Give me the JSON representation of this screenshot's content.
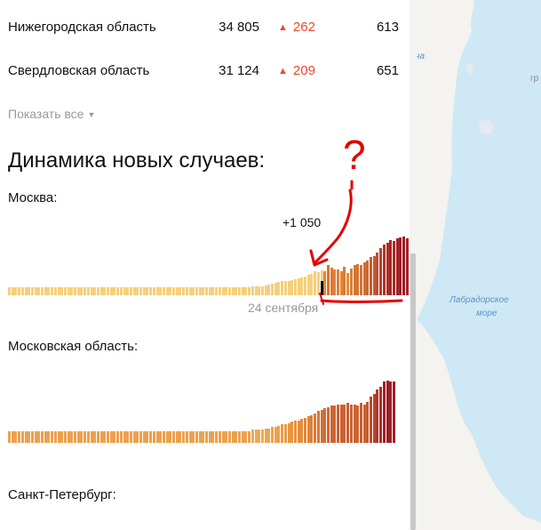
{
  "regions": [
    {
      "name": "Нижегородская область",
      "total": "34 805",
      "delta": "262",
      "deaths": "613"
    },
    {
      "name": "Свердловская область",
      "total": "31 124",
      "delta": "209",
      "deaths": "651"
    }
  ],
  "show_all": "Показать все",
  "dynamics_title": "Динамика новых случаев:",
  "charts": {
    "moscow": {
      "label": "Москва:",
      "annotation": "+1 050",
      "date": "24 сентября"
    },
    "moscow_oblast": {
      "label": "Московская область:"
    },
    "spb": {
      "label": "Санкт-Петербург:"
    }
  },
  "map": {
    "labels": [
      "Лабрадорское",
      "море",
      "на",
      "гр"
    ]
  },
  "annotation_mark": "?",
  "colors": {
    "accent_red": "#f0452c",
    "bar_light": "#f5d07a",
    "bar_dark": "#9e1c26",
    "map_water": "#cfe8f5",
    "map_land": "#f4f3ef"
  },
  "chart_data": [
    {
      "type": "bar",
      "title": "Москва:",
      "annotation": "+1 050",
      "x_tick": "24 сентября",
      "values": [
        9,
        9,
        9,
        9,
        9,
        9,
        9,
        9,
        9,
        9,
        9,
        9,
        9,
        9,
        9,
        9,
        9,
        9,
        9,
        9,
        9,
        9,
        9,
        9,
        9,
        9,
        9,
        9,
        9,
        9,
        9,
        9,
        9,
        9,
        9,
        9,
        9,
        9,
        9,
        9,
        9,
        9,
        9,
        9,
        9,
        9,
        9,
        9,
        9,
        9,
        9,
        9,
        9,
        9,
        9,
        9,
        9,
        9,
        9,
        9,
        9,
        9,
        9,
        9,
        9,
        9,
        9,
        9,
        9,
        9,
        9,
        9,
        9,
        9,
        10,
        10,
        10,
        10,
        11,
        12,
        13,
        14,
        15,
        16,
        16,
        16,
        17,
        18,
        19,
        20,
        21,
        23,
        24,
        27,
        26,
        28,
        27,
        33,
        31,
        29,
        29,
        27,
        32,
        25,
        30,
        33,
        34,
        33,
        36,
        38,
        42,
        43,
        47,
        52,
        56,
        58,
        61,
        60,
        63,
        64,
        65,
        63
      ]
    },
    {
      "type": "bar",
      "title": "Московская область:",
      "values": [
        9,
        9,
        9,
        9,
        9,
        9,
        9,
        9,
        9,
        9,
        9,
        9,
        9,
        9,
        9,
        9,
        9,
        9,
        9,
        9,
        9,
        9,
        9,
        9,
        9,
        9,
        9,
        9,
        9,
        9,
        9,
        9,
        9,
        9,
        9,
        9,
        9,
        9,
        9,
        9,
        9,
        9,
        9,
        9,
        9,
        9,
        9,
        9,
        9,
        9,
        9,
        9,
        9,
        9,
        9,
        9,
        9,
        9,
        9,
        9,
        9,
        9,
        9,
        9,
        9,
        9,
        9,
        9,
        9,
        9,
        9,
        9,
        9,
        9,
        10,
        10,
        10,
        10,
        11,
        11,
        12,
        12,
        13,
        14,
        14,
        15,
        16,
        17,
        17,
        18,
        19,
        20,
        21,
        22,
        24,
        25,
        26,
        27,
        28,
        28,
        29,
        29,
        29,
        30,
        29,
        29,
        28,
        30,
        29,
        31,
        35,
        37,
        40,
        42,
        46,
        47,
        46,
        46
      ]
    }
  ]
}
